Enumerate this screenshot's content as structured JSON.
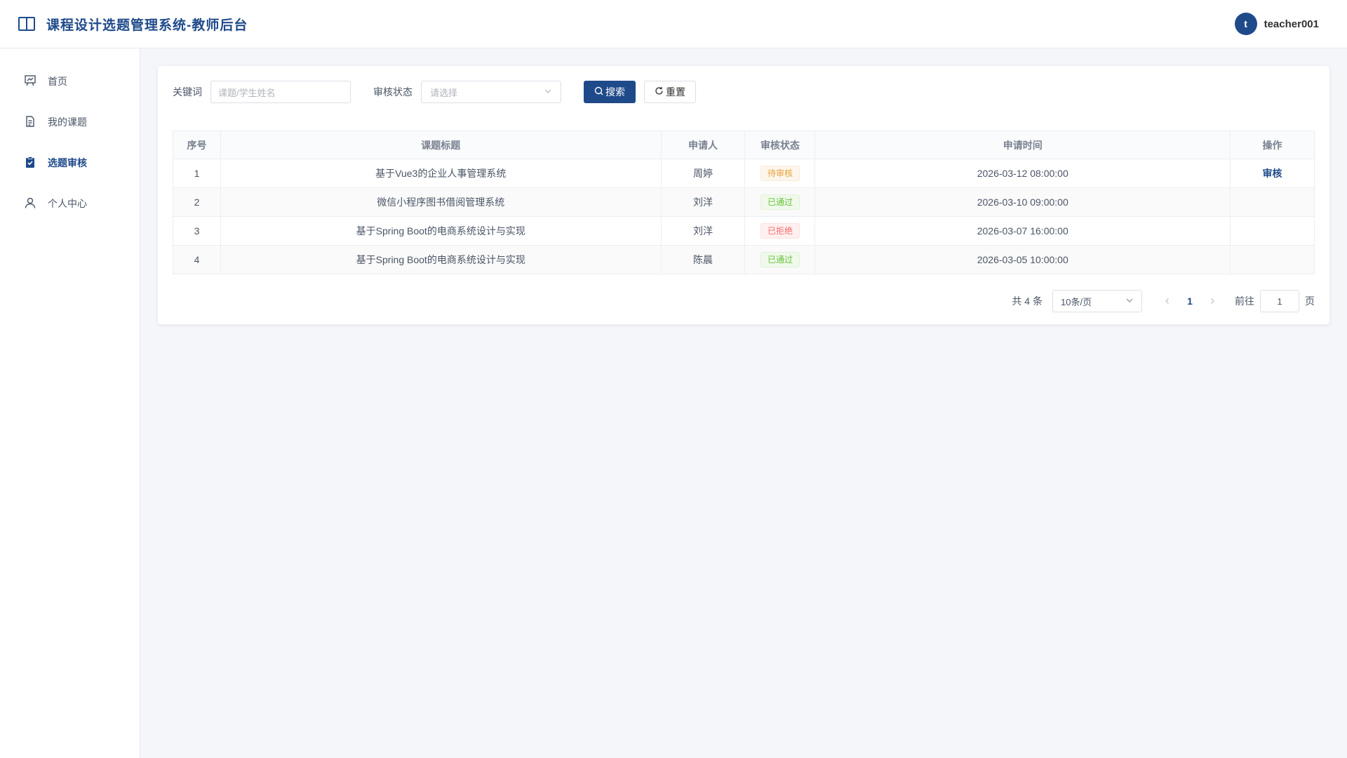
{
  "header": {
    "title": "课程设计选题管理系统-教师后台",
    "avatar_letter": "t",
    "username": "teacher001"
  },
  "sidebar": {
    "items": [
      {
        "label": "首页",
        "icon": "chart-board-icon",
        "active": false
      },
      {
        "label": "我的课题",
        "icon": "document-icon",
        "active": false
      },
      {
        "label": "选题审核",
        "icon": "clipboard-check-icon",
        "active": true
      },
      {
        "label": "个人中心",
        "icon": "user-icon",
        "active": false
      }
    ]
  },
  "filters": {
    "keyword_label": "关键词",
    "keyword_placeholder": "课题/学生姓名",
    "status_label": "审核状态",
    "status_placeholder": "请选择",
    "search_label": "搜索",
    "reset_label": "重置"
  },
  "table": {
    "columns": [
      "序号",
      "课题标题",
      "申请人",
      "审核状态",
      "申请时间",
      "操作"
    ],
    "rows": [
      {
        "index": "1",
        "title": "基于Vue3的企业人事管理系统",
        "applicant": "周婷",
        "status": "待审核",
        "status_type": "warning",
        "time": "2026-03-12 08:00:00",
        "action": "审核"
      },
      {
        "index": "2",
        "title": "微信小程序图书借阅管理系统",
        "applicant": "刘洋",
        "status": "已通过",
        "status_type": "success",
        "time": "2026-03-10 09:00:00",
        "action": ""
      },
      {
        "index": "3",
        "title": "基于Spring Boot的电商系统设计与实现",
        "applicant": "刘洋",
        "status": "已拒绝",
        "status_type": "danger",
        "time": "2026-03-07 16:00:00",
        "action": ""
      },
      {
        "index": "4",
        "title": "基于Spring Boot的电商系统设计与实现",
        "applicant": "陈晨",
        "status": "已通过",
        "status_type": "success",
        "time": "2026-03-05 10:00:00",
        "action": ""
      }
    ]
  },
  "pagination": {
    "total_text": "共 4 条",
    "page_size": "10条/页",
    "current_page": "1",
    "goto_label": "前往",
    "goto_value": "1",
    "page_unit": "页"
  },
  "colors": {
    "primary": "#1f4a8a",
    "warning": "#e6a23c",
    "success": "#67c23a",
    "danger": "#f56c6c"
  }
}
